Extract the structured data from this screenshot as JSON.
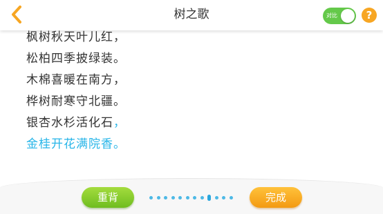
{
  "header": {
    "back_icon": "chevron-left-icon",
    "title": "树之歌",
    "compare_toggle": {
      "label": "对比",
      "on": true
    },
    "help_label": "?"
  },
  "poem": {
    "lines": [
      {
        "text": "枫树秋天叶儿红，",
        "punct": ""
      },
      {
        "text": "松柏四季披绿装。",
        "punct": ""
      },
      {
        "text": "木棉喜暖在南方，",
        "punct": ""
      },
      {
        "text": "桦树耐寒守北疆。",
        "punct": ""
      },
      {
        "text": "银杏水杉活化石",
        "punct": "，"
      },
      {
        "text": "金桂开花满院香。",
        "punct": ""
      }
    ],
    "current_line": 6
  },
  "footer": {
    "recite_label": "重背",
    "finish_label": "完成",
    "progress": {
      "total": 12,
      "current": 9
    }
  },
  "colors": {
    "accent_orange": "#f7a623",
    "current_line_blue": "#27b5e8",
    "toggle_green": "#64c94a",
    "recite_green": "#6fbd1f",
    "finish_orange": "#f39a12"
  }
}
